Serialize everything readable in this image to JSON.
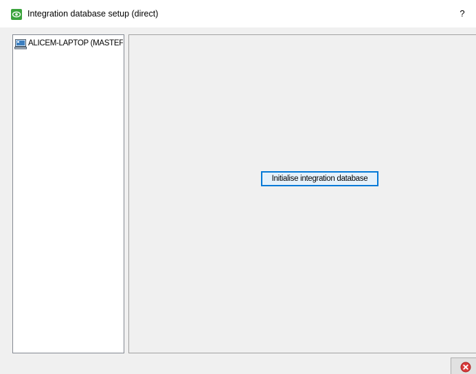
{
  "window": {
    "title": "Integration database setup (direct)",
    "help_label": "?"
  },
  "icons": {
    "app": "eye-app-icon",
    "tree_item": "computer-icon",
    "close": "close-icon"
  },
  "tree": {
    "items": [
      {
        "label": "ALICEM-LAPTOP (MASTEF"
      }
    ]
  },
  "main": {
    "init_button_label": "Initialise integration database"
  },
  "colors": {
    "accent": "#0078d7",
    "app_icon": "#3aa33c",
    "close_icon": "#d93a3a"
  }
}
